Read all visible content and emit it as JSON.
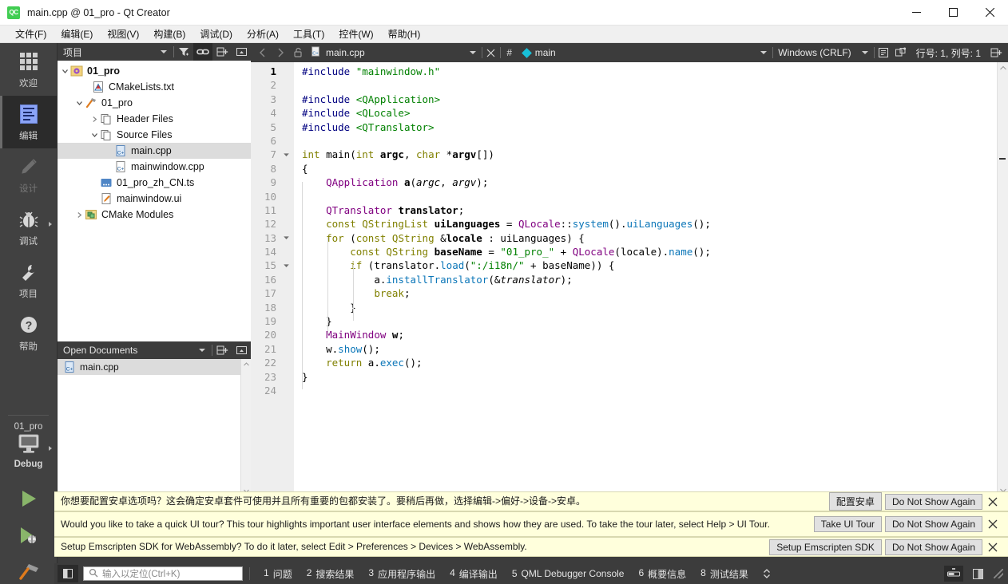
{
  "window": {
    "title": "main.cpp @ 01_pro - Qt Creator",
    "logo": "qt-creator-logo",
    "minimize": "minimize-icon",
    "maximize": "maximize-icon",
    "close": "close-icon"
  },
  "menubar": {
    "items": [
      {
        "label": "文件(F)",
        "name": "menu-file"
      },
      {
        "label": "编辑(E)",
        "name": "menu-edit"
      },
      {
        "label": "视图(V)",
        "name": "menu-view"
      },
      {
        "label": "构建(B)",
        "name": "menu-build"
      },
      {
        "label": "调试(D)",
        "name": "menu-debug"
      },
      {
        "label": "分析(A)",
        "name": "menu-analyze"
      },
      {
        "label": "工具(T)",
        "name": "menu-tools"
      },
      {
        "label": "控件(W)",
        "name": "menu-widgets"
      },
      {
        "label": "帮助(H)",
        "name": "menu-help"
      }
    ]
  },
  "modebar": {
    "modes": [
      {
        "label": "欢迎",
        "icon": "grid-icon",
        "active": false,
        "disabled": false,
        "arrow": false
      },
      {
        "label": "编辑",
        "icon": "document-lines-icon",
        "active": true,
        "disabled": false,
        "arrow": false
      },
      {
        "label": "设计",
        "icon": "pencil-icon",
        "active": false,
        "disabled": true,
        "arrow": false
      },
      {
        "label": "调试",
        "icon": "bug-icon",
        "active": false,
        "disabled": false,
        "arrow": true
      },
      {
        "label": "项目",
        "icon": "wrench-icon",
        "active": false,
        "disabled": false,
        "arrow": false
      },
      {
        "label": "帮助",
        "icon": "question-circle-icon",
        "active": false,
        "disabled": false,
        "arrow": false
      }
    ],
    "kit": {
      "project": "01_pro",
      "icon": "desktop-icon",
      "config": "Debug"
    },
    "run_buttons": [
      {
        "name": "run-button",
        "icon": "play-icon"
      },
      {
        "name": "debug-button",
        "icon": "play-bug-icon"
      },
      {
        "name": "build-button",
        "icon": "hammer-icon"
      }
    ]
  },
  "project_panel": {
    "title": "项目",
    "toolbar": [
      {
        "name": "filter-button",
        "icon": "filter-icon",
        "active": false
      },
      {
        "name": "link-with-editor-button",
        "icon": "link-icon",
        "active": true
      },
      {
        "name": "split-button",
        "icon": "split-add-icon",
        "active": false
      },
      {
        "name": "close-sidebar-button",
        "icon": "close-split-icon",
        "active": false
      }
    ],
    "tree": [
      {
        "label": "01_pro",
        "icon": "project-gear-icon",
        "indent": 0,
        "twisty": "open",
        "bold": true,
        "selected": false
      },
      {
        "label": "CMakeLists.txt",
        "icon": "cmake-file-icon",
        "indent": 1,
        "twisty": "none",
        "bold": false,
        "selected": false
      },
      {
        "label": "01_pro",
        "icon": "target-hammer-icon",
        "indent": 1,
        "twisty": "open",
        "bold": false,
        "selected": false
      },
      {
        "label": "Header Files",
        "icon": "folder-files-icon",
        "indent": 2,
        "twisty": "closed",
        "bold": false,
        "selected": false
      },
      {
        "label": "Source Files",
        "icon": "folder-files-icon",
        "indent": 2,
        "twisty": "open",
        "bold": false,
        "selected": false
      },
      {
        "label": "main.cpp",
        "icon": "cpp-file-icon",
        "indent": 4,
        "twisty": "none",
        "bold": false,
        "selected": true
      },
      {
        "label": "mainwindow.cpp",
        "icon": "cpp-file-icon",
        "indent": 4,
        "twisty": "none",
        "bold": false,
        "selected": false
      },
      {
        "label": "01_pro_zh_CN.ts",
        "icon": "ts-file-icon",
        "indent": 2,
        "twisty": "none",
        "bold": false,
        "selected": false
      },
      {
        "label": "mainwindow.ui",
        "icon": "ui-file-icon",
        "indent": 2,
        "twisty": "none",
        "bold": false,
        "selected": false
      },
      {
        "label": "CMake Modules",
        "icon": "cmake-modules-icon",
        "indent": 1,
        "twisty": "closed",
        "bold": false,
        "selected": false
      }
    ]
  },
  "open_documents": {
    "title": "Open Documents",
    "toolbar": [
      {
        "name": "opendocs-menu-button",
        "icon": "chevron-down-icon"
      },
      {
        "name": "opendocs-split-button",
        "icon": "split-add-icon"
      },
      {
        "name": "opendocs-close-button",
        "icon": "close-split-icon"
      }
    ],
    "items": [
      {
        "label": "main.cpp",
        "icon": "cpp-file-icon",
        "selected": true
      }
    ]
  },
  "editor": {
    "toolbar": {
      "back": "back-arrow-icon",
      "forward": "forward-arrow-icon",
      "lock": "unlocked-icon",
      "file_icon": "cpp-file-icon",
      "file_name": "main.cpp",
      "dropdown": "chevron-down-icon",
      "close": "close-icon",
      "hash": "#",
      "symbol_icon": "diamond-icon",
      "symbol": "main",
      "symbol_dropdown": "chevron-down-icon",
      "encoding": "Windows (CRLF)",
      "encoding_dropdown": "chevron-down-icon",
      "wrap_icon": "line-wrap-icon",
      "indent_icon": "indent-icon",
      "line_info": "行号: 1, 列号: 1",
      "split_icon": "split-add-icon"
    },
    "gutter": {
      "current_line": 1,
      "fold_lines": [
        7,
        13,
        15
      ]
    },
    "code_lines": [
      {
        "n": 1,
        "tokens": [
          {
            "t": "#include ",
            "c": "t-pre"
          },
          {
            "t": "\"mainwindow.h\"",
            "c": "t-str"
          }
        ]
      },
      {
        "n": 2,
        "tokens": []
      },
      {
        "n": 3,
        "tokens": [
          {
            "t": "#include ",
            "c": "t-pre"
          },
          {
            "t": "<QApplication>",
            "c": "t-str"
          }
        ]
      },
      {
        "n": 4,
        "tokens": [
          {
            "t": "#include ",
            "c": "t-pre"
          },
          {
            "t": "<QLocale>",
            "c": "t-str"
          }
        ]
      },
      {
        "n": 5,
        "tokens": [
          {
            "t": "#include ",
            "c": "t-pre"
          },
          {
            "t": "<QTranslator>",
            "c": "t-str"
          }
        ]
      },
      {
        "n": 6,
        "tokens": []
      },
      {
        "n": 7,
        "tokens": [
          {
            "t": "int",
            "c": "t-kw"
          },
          {
            "t": " ",
            "c": "t-plain"
          },
          {
            "t": "main",
            "c": "t-plain"
          },
          {
            "t": "(",
            "c": "t-plain"
          },
          {
            "t": "int",
            "c": "t-kw"
          },
          {
            "t": " ",
            "c": "t-plain"
          },
          {
            "t": "argc",
            "c": "t-var"
          },
          {
            "t": ", ",
            "c": "t-plain"
          },
          {
            "t": "char",
            "c": "t-kw"
          },
          {
            "t": " *",
            "c": "t-plain"
          },
          {
            "t": "argv",
            "c": "t-var"
          },
          {
            "t": "[])",
            "c": "t-plain"
          }
        ]
      },
      {
        "n": 8,
        "tokens": [
          {
            "t": "{",
            "c": "t-plain"
          }
        ]
      },
      {
        "n": 9,
        "tokens": [
          {
            "t": "    ",
            "c": "t-plain"
          },
          {
            "t": "QApplication",
            "c": "t-type"
          },
          {
            "t": " ",
            "c": "t-plain"
          },
          {
            "t": "a",
            "c": "t-var"
          },
          {
            "t": "(",
            "c": "t-plain"
          },
          {
            "t": "argc",
            "c": "t-arg"
          },
          {
            "t": ", ",
            "c": "t-plain"
          },
          {
            "t": "argv",
            "c": "t-arg"
          },
          {
            "t": ");",
            "c": "t-plain"
          }
        ]
      },
      {
        "n": 10,
        "tokens": []
      },
      {
        "n": 11,
        "tokens": [
          {
            "t": "    ",
            "c": "t-plain"
          },
          {
            "t": "QTranslator",
            "c": "t-type"
          },
          {
            "t": " ",
            "c": "t-plain"
          },
          {
            "t": "translator",
            "c": "t-var"
          },
          {
            "t": ";",
            "c": "t-plain"
          }
        ]
      },
      {
        "n": 12,
        "tokens": [
          {
            "t": "    ",
            "c": "t-plain"
          },
          {
            "t": "const",
            "c": "t-kw"
          },
          {
            "t": " ",
            "c": "t-plain"
          },
          {
            "t": "QStringList",
            "c": "t-kw"
          },
          {
            "t": " ",
            "c": "t-plain"
          },
          {
            "t": "uiLanguages",
            "c": "t-var"
          },
          {
            "t": " = ",
            "c": "t-plain"
          },
          {
            "t": "QLocale",
            "c": "t-type"
          },
          {
            "t": "::",
            "c": "t-plain"
          },
          {
            "t": "system",
            "c": "t-fn"
          },
          {
            "t": "().",
            "c": "t-plain"
          },
          {
            "t": "uiLanguages",
            "c": "t-fn"
          },
          {
            "t": "();",
            "c": "t-plain"
          }
        ]
      },
      {
        "n": 13,
        "tokens": [
          {
            "t": "    ",
            "c": "t-plain"
          },
          {
            "t": "for",
            "c": "t-kw"
          },
          {
            "t": " (",
            "c": "t-plain"
          },
          {
            "t": "const",
            "c": "t-kw"
          },
          {
            "t": " ",
            "c": "t-plain"
          },
          {
            "t": "QString",
            "c": "t-kw"
          },
          {
            "t": " &",
            "c": "t-plain"
          },
          {
            "t": "locale",
            "c": "t-var"
          },
          {
            "t": " : ",
            "c": "t-plain"
          },
          {
            "t": "uiLanguages",
            "c": "t-plain"
          },
          {
            "t": ") {",
            "c": "t-plain"
          }
        ]
      },
      {
        "n": 14,
        "tokens": [
          {
            "t": "        ",
            "c": "t-plain"
          },
          {
            "t": "const",
            "c": "t-kw"
          },
          {
            "t": " ",
            "c": "t-plain"
          },
          {
            "t": "QString",
            "c": "t-kw"
          },
          {
            "t": " ",
            "c": "t-plain"
          },
          {
            "t": "baseName",
            "c": "t-var"
          },
          {
            "t": " = ",
            "c": "t-plain"
          },
          {
            "t": "\"01_pro_\"",
            "c": "t-str"
          },
          {
            "t": " + ",
            "c": "t-plain"
          },
          {
            "t": "QLocale",
            "c": "t-type"
          },
          {
            "t": "(",
            "c": "t-plain"
          },
          {
            "t": "locale",
            "c": "t-plain"
          },
          {
            "t": ").",
            "c": "t-plain"
          },
          {
            "t": "name",
            "c": "t-fn"
          },
          {
            "t": "();",
            "c": "t-plain"
          }
        ]
      },
      {
        "n": 15,
        "tokens": [
          {
            "t": "        ",
            "c": "t-plain"
          },
          {
            "t": "if",
            "c": "t-kw"
          },
          {
            "t": " (",
            "c": "t-plain"
          },
          {
            "t": "translator",
            "c": "t-plain"
          },
          {
            "t": ".",
            "c": "t-plain"
          },
          {
            "t": "load",
            "c": "t-fn"
          },
          {
            "t": "(",
            "c": "t-plain"
          },
          {
            "t": "\":/i18n/\"",
            "c": "t-str"
          },
          {
            "t": " + ",
            "c": "t-plain"
          },
          {
            "t": "baseName",
            "c": "t-plain"
          },
          {
            "t": ")) {",
            "c": "t-plain"
          }
        ]
      },
      {
        "n": 16,
        "tokens": [
          {
            "t": "            ",
            "c": "t-plain"
          },
          {
            "t": "a",
            "c": "t-plain"
          },
          {
            "t": ".",
            "c": "t-plain"
          },
          {
            "t": "installTranslator",
            "c": "t-fn"
          },
          {
            "t": "(&",
            "c": "t-plain"
          },
          {
            "t": "translator",
            "c": "t-arg"
          },
          {
            "t": ");",
            "c": "t-plain"
          }
        ]
      },
      {
        "n": 17,
        "tokens": [
          {
            "t": "            ",
            "c": "t-plain"
          },
          {
            "t": "break",
            "c": "t-kw"
          },
          {
            "t": ";",
            "c": "t-plain"
          }
        ]
      },
      {
        "n": 18,
        "tokens": [
          {
            "t": "        }",
            "c": "t-plain"
          }
        ]
      },
      {
        "n": 19,
        "tokens": [
          {
            "t": "    }",
            "c": "t-plain"
          }
        ]
      },
      {
        "n": 20,
        "tokens": [
          {
            "t": "    ",
            "c": "t-plain"
          },
          {
            "t": "MainWindow",
            "c": "t-type"
          },
          {
            "t": " ",
            "c": "t-plain"
          },
          {
            "t": "w",
            "c": "t-var"
          },
          {
            "t": ";",
            "c": "t-plain"
          }
        ]
      },
      {
        "n": 21,
        "tokens": [
          {
            "t": "    ",
            "c": "t-plain"
          },
          {
            "t": "w",
            "c": "t-plain"
          },
          {
            "t": ".",
            "c": "t-plain"
          },
          {
            "t": "show",
            "c": "t-fn"
          },
          {
            "t": "();",
            "c": "t-plain"
          }
        ]
      },
      {
        "n": 22,
        "tokens": [
          {
            "t": "    ",
            "c": "t-plain"
          },
          {
            "t": "return",
            "c": "t-kw"
          },
          {
            "t": " ",
            "c": "t-plain"
          },
          {
            "t": "a",
            "c": "t-plain"
          },
          {
            "t": ".",
            "c": "t-plain"
          },
          {
            "t": "exec",
            "c": "t-fn"
          },
          {
            "t": "();",
            "c": "t-plain"
          }
        ]
      },
      {
        "n": 23,
        "tokens": [
          {
            "t": "}",
            "c": "t-plain"
          }
        ]
      },
      {
        "n": 24,
        "tokens": []
      }
    ]
  },
  "info_bars": [
    {
      "name": "android-setup-infobar",
      "text": "你想要配置安卓选项吗？这会确定安卓套件可使用并且所有重要的包都安装了。要稍后再做，选择编辑->偏好->设备->安卓。",
      "action": "配置安卓",
      "dismiss": "Do Not Show Again",
      "close": "close-icon"
    },
    {
      "name": "ui-tour-infobar",
      "text": "Would you like to take a quick UI tour? This tour highlights important user interface elements and shows how they are used. To take the tour later, select Help > UI Tour.",
      "action": "Take UI Tour",
      "dismiss": "Do Not Show Again",
      "close": "close-icon"
    },
    {
      "name": "emscripten-infobar",
      "text": "Setup Emscripten SDK for WebAssembly? To do it later, select Edit > Preferences > Devices > WebAssembly.",
      "action": "Setup Emscripten SDK",
      "dismiss": "Do Not Show Again",
      "close": "close-icon"
    }
  ],
  "statusbar": {
    "sidebar_toggle": "sidebar-toggle-icon",
    "locator_placeholder": "输入以定位(Ctrl+K)",
    "locator_value": "",
    "locator_icon": "search-icon",
    "panes": [
      {
        "num": "1",
        "label": "问题",
        "name": "pane-issues"
      },
      {
        "num": "2",
        "label": "搜索结果",
        "name": "pane-search-results"
      },
      {
        "num": "3",
        "label": "应用程序输出",
        "name": "pane-application-output"
      },
      {
        "num": "4",
        "label": "编译输出",
        "name": "pane-compile-output"
      },
      {
        "num": "5",
        "label": "QML Debugger Console",
        "name": "pane-qml-debugger-console"
      },
      {
        "num": "6",
        "label": "概要信息",
        "name": "pane-general-messages"
      },
      {
        "num": "8",
        "label": "测试结果",
        "name": "pane-test-results"
      }
    ],
    "updown": "up-down-arrows-icon",
    "right_buttons": [
      {
        "name": "progress-details-button",
        "icon": "progress-bar-icon",
        "active": true
      },
      {
        "name": "output-pane-toggle-button",
        "icon": "panel-toggle-icon",
        "active": false
      }
    ],
    "resizer": "resize-grip-icon"
  },
  "colors": {
    "accent_green": "#41cd52",
    "dark_chrome": "#3c3c3c",
    "mode_active": "#2b2b2b",
    "infobar_bg": "#ffffdc",
    "selection": "#dcdcdc",
    "symbol_cyan": "#18c0d8"
  }
}
